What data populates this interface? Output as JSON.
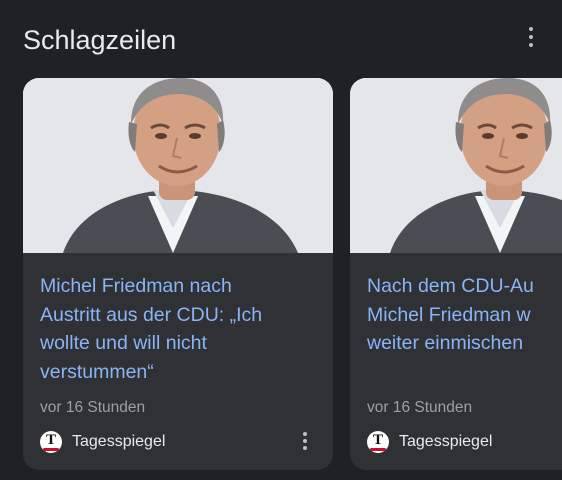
{
  "header": {
    "title": "Schlagzeilen",
    "menu_icon": "more-vert-icon"
  },
  "cards": [
    {
      "headline": "Michel Friedman nach\nAustritt aus der CDU: „Ich\nwollte und will nicht\nverstummen“",
      "time": "vor 16 Stunden",
      "source": {
        "name": "Tagesspiegel",
        "logo_letter": "T"
      },
      "menu_icon": "more-vert-icon"
    },
    {
      "headline": "Nach dem CDU-Au\nMichel Friedman w\nweiter einmischen",
      "time": "vor 16 Stunden",
      "source": {
        "name": "Tagesspiegel",
        "logo_letter": "T"
      }
    }
  ],
  "colors": {
    "background": "#202124",
    "card": "#303134",
    "headline": "#8ab4f8",
    "meta_text": "#9aa0a6",
    "title_text": "#e8eaed",
    "logo_accent": "#c8102e"
  }
}
